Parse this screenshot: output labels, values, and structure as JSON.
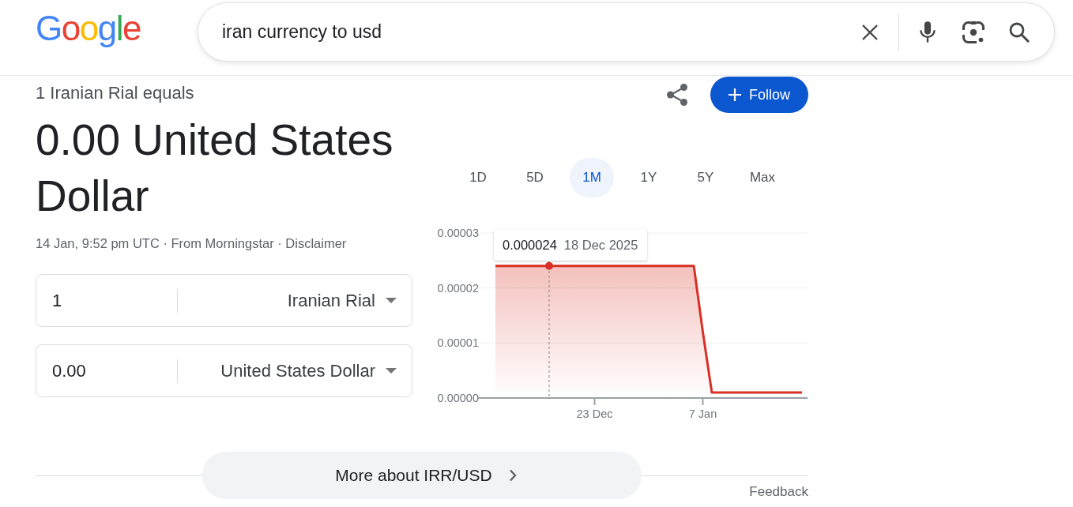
{
  "header": {
    "logo": "Google",
    "search": {
      "query": "iran currency to usd"
    }
  },
  "result": {
    "subtitle": "1 Iranian Rial equals",
    "headline": "0.00 United States Dollar",
    "meta": "14 Jan, 9:52 pm UTC · From Morningstar · ",
    "disclaimer_link": "Disclaimer",
    "follow_button": "Follow"
  },
  "converter": [
    {
      "amount": "1",
      "currency": "Iranian Rial"
    },
    {
      "amount": "0.00",
      "currency": "United States Dollar"
    }
  ],
  "chart": {
    "ranges": [
      {
        "label": "1D",
        "selected": false
      },
      {
        "label": "5D",
        "selected": false
      },
      {
        "label": "1M",
        "selected": true
      },
      {
        "label": "1Y",
        "selected": false
      },
      {
        "label": "5Y",
        "selected": false
      },
      {
        "label": "Max",
        "selected": false
      }
    ],
    "tooltip": {
      "value": "0.000024",
      "date": "18 Dec 2025"
    },
    "chart_data": {
      "type": "area",
      "categories": [
        null,
        null,
        null,
        null,
        null,
        null,
        null,
        null,
        null,
        null,
        null,
        "23 Dec",
        null,
        null,
        null,
        null,
        null,
        null,
        null,
        null,
        null,
        null,
        null,
        "7 Jan",
        null,
        null,
        null,
        null,
        null,
        null,
        null,
        null,
        null,
        null,
        null
      ],
      "series": [
        {
          "color": "#d93025",
          "values": [
            2.4e-05,
            2.4e-05,
            2.4e-05,
            2.4e-05,
            2.4e-05,
            2.4e-05,
            2.4e-05,
            2.4e-05,
            2.4e-05,
            2.4e-05,
            2.4e-05,
            2.4e-05,
            2.4e-05,
            2.4e-05,
            2.4e-05,
            2.4e-05,
            2.4e-05,
            2.4e-05,
            2.4e-05,
            2.4e-05,
            2.4e-05,
            2.4e-05,
            2.4e-05,
            1.2e-05,
            1e-06,
            1e-06,
            1e-06,
            1e-06,
            1e-06,
            1e-06,
            1e-06,
            1e-06,
            1e-06,
            1e-06,
            1e-06
          ]
        }
      ],
      "ylim": [
        0,
        3e-05
      ],
      "yticks": [
        {
          "value": 0,
          "label": "0.00000"
        },
        {
          "value": 1e-05,
          "label": "0.00001"
        },
        {
          "value": 2e-05,
          "label": "0.00002"
        },
        {
          "value": 3e-05,
          "label": "0.00003"
        }
      ]
    }
  },
  "more_button": "More about IRR/USD",
  "feedback": "Feedback"
}
